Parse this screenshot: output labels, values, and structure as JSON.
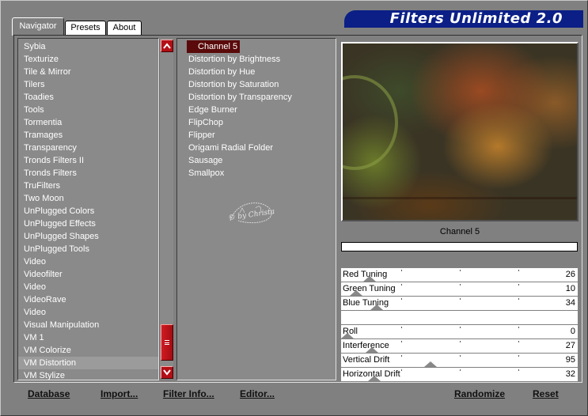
{
  "app": {
    "title": "Filters Unlimited 2.0"
  },
  "tabs": [
    {
      "label": "Navigator",
      "active": true
    },
    {
      "label": "Presets",
      "active": false
    },
    {
      "label": "About",
      "active": false
    }
  ],
  "categories": {
    "items": [
      "Sybia",
      "Texturize",
      "Tile & Mirror",
      "Tilers",
      "Toadies",
      "Tools",
      "Tormentia",
      "Tramages",
      "Transparency",
      "Tronds Filters II",
      "Tronds Filters",
      "TruFilters",
      "Two Moon",
      "UnPlugged Colors",
      "UnPlugged Effects",
      "UnPlugged Shapes",
      "UnPlugged Tools",
      "Video",
      "Videofilter",
      "Video",
      "VideoRave",
      "Video",
      "Visual Manipulation",
      "VM 1",
      "VM Colorize",
      "VM Distortion",
      "VM Stylize"
    ],
    "selected_index": 25
  },
  "filters": {
    "items": [
      "Channel 5",
      "Distortion by Brightness",
      "Distortion by Hue",
      "Distortion by Saturation",
      "Distortion by Transparency",
      "Edge Burner",
      "FlipChop",
      "Flipper",
      "Origami Radial Folder",
      "Sausage",
      "Smallpox"
    ],
    "selected_index": 0
  },
  "watermark": {
    "text": "© by Christa"
  },
  "preview": {
    "filter_name": "Channel 5"
  },
  "sliders": [
    {
      "label": "Red Tuning",
      "value": "26",
      "fraction": 0.1
    },
    {
      "label": "Green Tuning",
      "value": "10",
      "fraction": 0.04
    },
    {
      "label": "Blue Tuning",
      "value": "34",
      "fraction": 0.13
    },
    {
      "label": "Roll",
      "value": "0",
      "fraction": 0.0
    },
    {
      "label": "Interference",
      "value": "27",
      "fraction": 0.11
    },
    {
      "label": "Vertical Drift",
      "value": "95",
      "fraction": 0.37
    },
    {
      "label": "Horizontal Drift",
      "value": "32",
      "fraction": 0.12
    }
  ],
  "buttons": {
    "database": "Database",
    "import": "Import...",
    "filter_info": "Filter Info...",
    "editor": "Editor...",
    "randomize": "Randomize",
    "reset": "Reset"
  },
  "colors": {
    "banner": "#0b1f86",
    "scrollbar": "#b30f17",
    "selection": "#5a0a0a"
  }
}
